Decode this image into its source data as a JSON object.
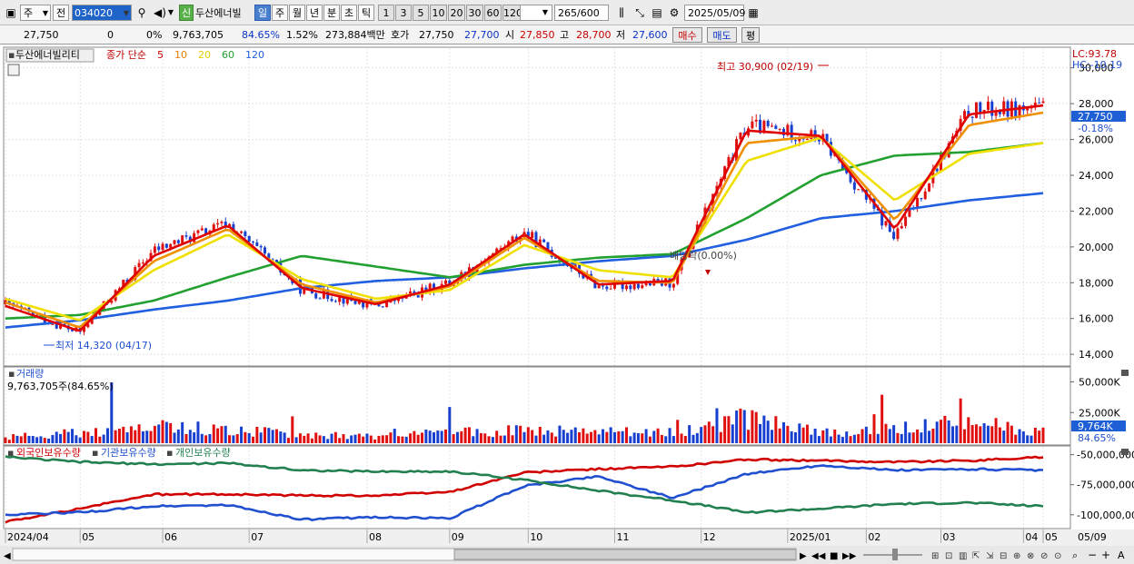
{
  "toolbar": {
    "period_main": "주",
    "prev_label": "전",
    "stock_code": "034020",
    "badge_new": "신",
    "stock_name": "두산에너빌",
    "periods": [
      "일",
      "주",
      "월",
      "년",
      "분",
      "초",
      "틱"
    ],
    "active_period": "일",
    "minute_options": [
      "1",
      "3",
      "5",
      "10",
      "20",
      "30",
      "60",
      "120"
    ],
    "range_text": "265",
    "range_max": "/600",
    "date": "2025/05/09"
  },
  "info": {
    "price": "27,750",
    "change": "0",
    "change_rate": "0%",
    "volume": "9,763,705",
    "volume_ratio": "84.65%",
    "turnover": "1.52%",
    "amount": "273,884백만",
    "quote_label": "호가",
    "ask": "27,750",
    "bid": "27,700",
    "open_label": "시",
    "open": "27,850",
    "high_label": "고",
    "high": "28,700",
    "low_label": "저",
    "low": "27,600",
    "buy_label": "매수",
    "sell_label": "매도",
    "avg_label": "평"
  },
  "price_panel": {
    "title": "두산에너빌리티",
    "legend_prefix": "종가 단순",
    "ma_periods": [
      "5",
      "10",
      "20",
      "60",
      "120"
    ],
    "ma_colors": [
      "#e00000",
      "#f09000",
      "#f0e000",
      "#22a030",
      "#2060e0"
    ],
    "lc_label": "LC:93.78",
    "hc_label": "HC:-10.19",
    "y_ticks": [
      "30,000",
      "28,000",
      "26,000",
      "24,000",
      "22,000",
      "20,000",
      "18,000",
      "16,000",
      "14,000"
    ],
    "current_price_tag": "27,750",
    "current_rate_tag": "-0.18%",
    "high_annotation": "최고 30,900 (02/19)",
    "low_annotation": "최저 14,320 (04/17)",
    "dividend_annotation": "배당락(0.00%)"
  },
  "volume_panel": {
    "title": "거래량",
    "value_label": "9,763,705주(84.65%)",
    "y_ticks": [
      "50,000K",
      "25,000K"
    ],
    "current_tag": "9,764K",
    "ratio_tag": "84.65%"
  },
  "holding_panel": {
    "series": [
      {
        "name": "외국인보유수량",
        "color": "#d00000"
      },
      {
        "name": "기관보유수량",
        "color": "#2050d0"
      },
      {
        "name": "개인보유수량",
        "color": "#228050"
      }
    ],
    "y_ticks": [
      "-50,000,000",
      "-75,000,000",
      "-100,000,000"
    ]
  },
  "x_axis": {
    "labels": [
      "2024/04",
      "05",
      "06",
      "07",
      "08",
      "09",
      "10",
      "11",
      "12",
      "2025/01",
      "02",
      "03",
      "04",
      "05"
    ],
    "end_label": "05/09"
  },
  "chart_data": [
    {
      "type": "line",
      "title": "두산에너빌리티",
      "x": [
        "2024/04",
        "05",
        "06",
        "07",
        "08",
        "09",
        "10",
        "11",
        "12",
        "2025/01",
        "02",
        "03",
        "04",
        "05",
        "05/09"
      ],
      "series": [
        {
          "name": "종가",
          "values": [
            16800,
            15200,
            19800,
            21300,
            17600,
            16700,
            18000,
            20800,
            17800,
            18000,
            26800,
            26100,
            20500,
            27600,
            27750
          ]
        },
        {
          "name": "5",
          "values": [
            16700,
            15300,
            19500,
            21200,
            17700,
            16800,
            17900,
            20700,
            17900,
            18100,
            26500,
            26200,
            21000,
            27400,
            27900
          ]
        },
        {
          "name": "10",
          "values": [
            16900,
            15500,
            19200,
            21000,
            17900,
            16900,
            17800,
            20500,
            18100,
            18000,
            25800,
            26200,
            21500,
            26800,
            27500
          ]
        },
        {
          "name": "20",
          "values": [
            17100,
            15900,
            18700,
            20700,
            18200,
            17100,
            17600,
            20100,
            18700,
            18300,
            24800,
            26100,
            22600,
            25200,
            25800
          ]
        },
        {
          "name": "60",
          "values": [
            16000,
            16200,
            17000,
            18300,
            19500,
            18900,
            18300,
            19000,
            19400,
            19600,
            21600,
            24000,
            25100,
            25300,
            25800
          ]
        },
        {
          "name": "120",
          "values": [
            15500,
            15900,
            16500,
            17000,
            17700,
            18100,
            18300,
            18800,
            19200,
            19500,
            20400,
            21600,
            22000,
            22600,
            23000
          ]
        }
      ],
      "ylim": [
        13500,
        31000
      ],
      "annotations": [
        "최고 30,900 (02/19)",
        "최저 14,320 (04/17)",
        "배당락(0.00%)"
      ]
    },
    {
      "type": "bar",
      "title": "거래량",
      "categories": [
        "2024/04",
        "05",
        "06",
        "07",
        "08",
        "09",
        "10",
        "11",
        "12",
        "2025/01",
        "02",
        "03",
        "04",
        "05",
        "05/09"
      ],
      "values": [
        5000,
        9000,
        14000,
        12000,
        7000,
        6000,
        9000,
        11000,
        10000,
        9000,
        22000,
        9000,
        12000,
        18000,
        9764
      ],
      "unit": "K",
      "ylim": [
        0,
        60000
      ]
    },
    {
      "type": "line",
      "x": [
        "2024/04",
        "05",
        "06",
        "07",
        "08",
        "09",
        "10",
        "11",
        "12",
        "2025/01",
        "02",
        "03",
        "04",
        "05",
        "05/09"
      ],
      "series": [
        {
          "name": "외국인보유수량",
          "values": [
            -106000000,
            -95000000,
            -83000000,
            -83000000,
            -84000000,
            -84000000,
            -81000000,
            -65000000,
            -62000000,
            -60000000,
            -54000000,
            -55000000,
            -56000000,
            -55000000,
            -52000000
          ]
        },
        {
          "name": "기관보유수량",
          "values": [
            -100000000,
            -98000000,
            -93000000,
            -92000000,
            -104000000,
            -102000000,
            -103000000,
            -76000000,
            -68000000,
            -86000000,
            -66000000,
            -59000000,
            -63000000,
            -62000000,
            -63000000
          ]
        },
        {
          "name": "개인보유수량",
          "values": [
            -52000000,
            -56000000,
            -58000000,
            -57000000,
            -63000000,
            -64000000,
            -64000000,
            -71000000,
            -80000000,
            -88000000,
            -98000000,
            -95000000,
            -91000000,
            -90000000,
            -93000000
          ]
        }
      ],
      "ylim": [
        -110000000,
        -45000000
      ]
    }
  ]
}
